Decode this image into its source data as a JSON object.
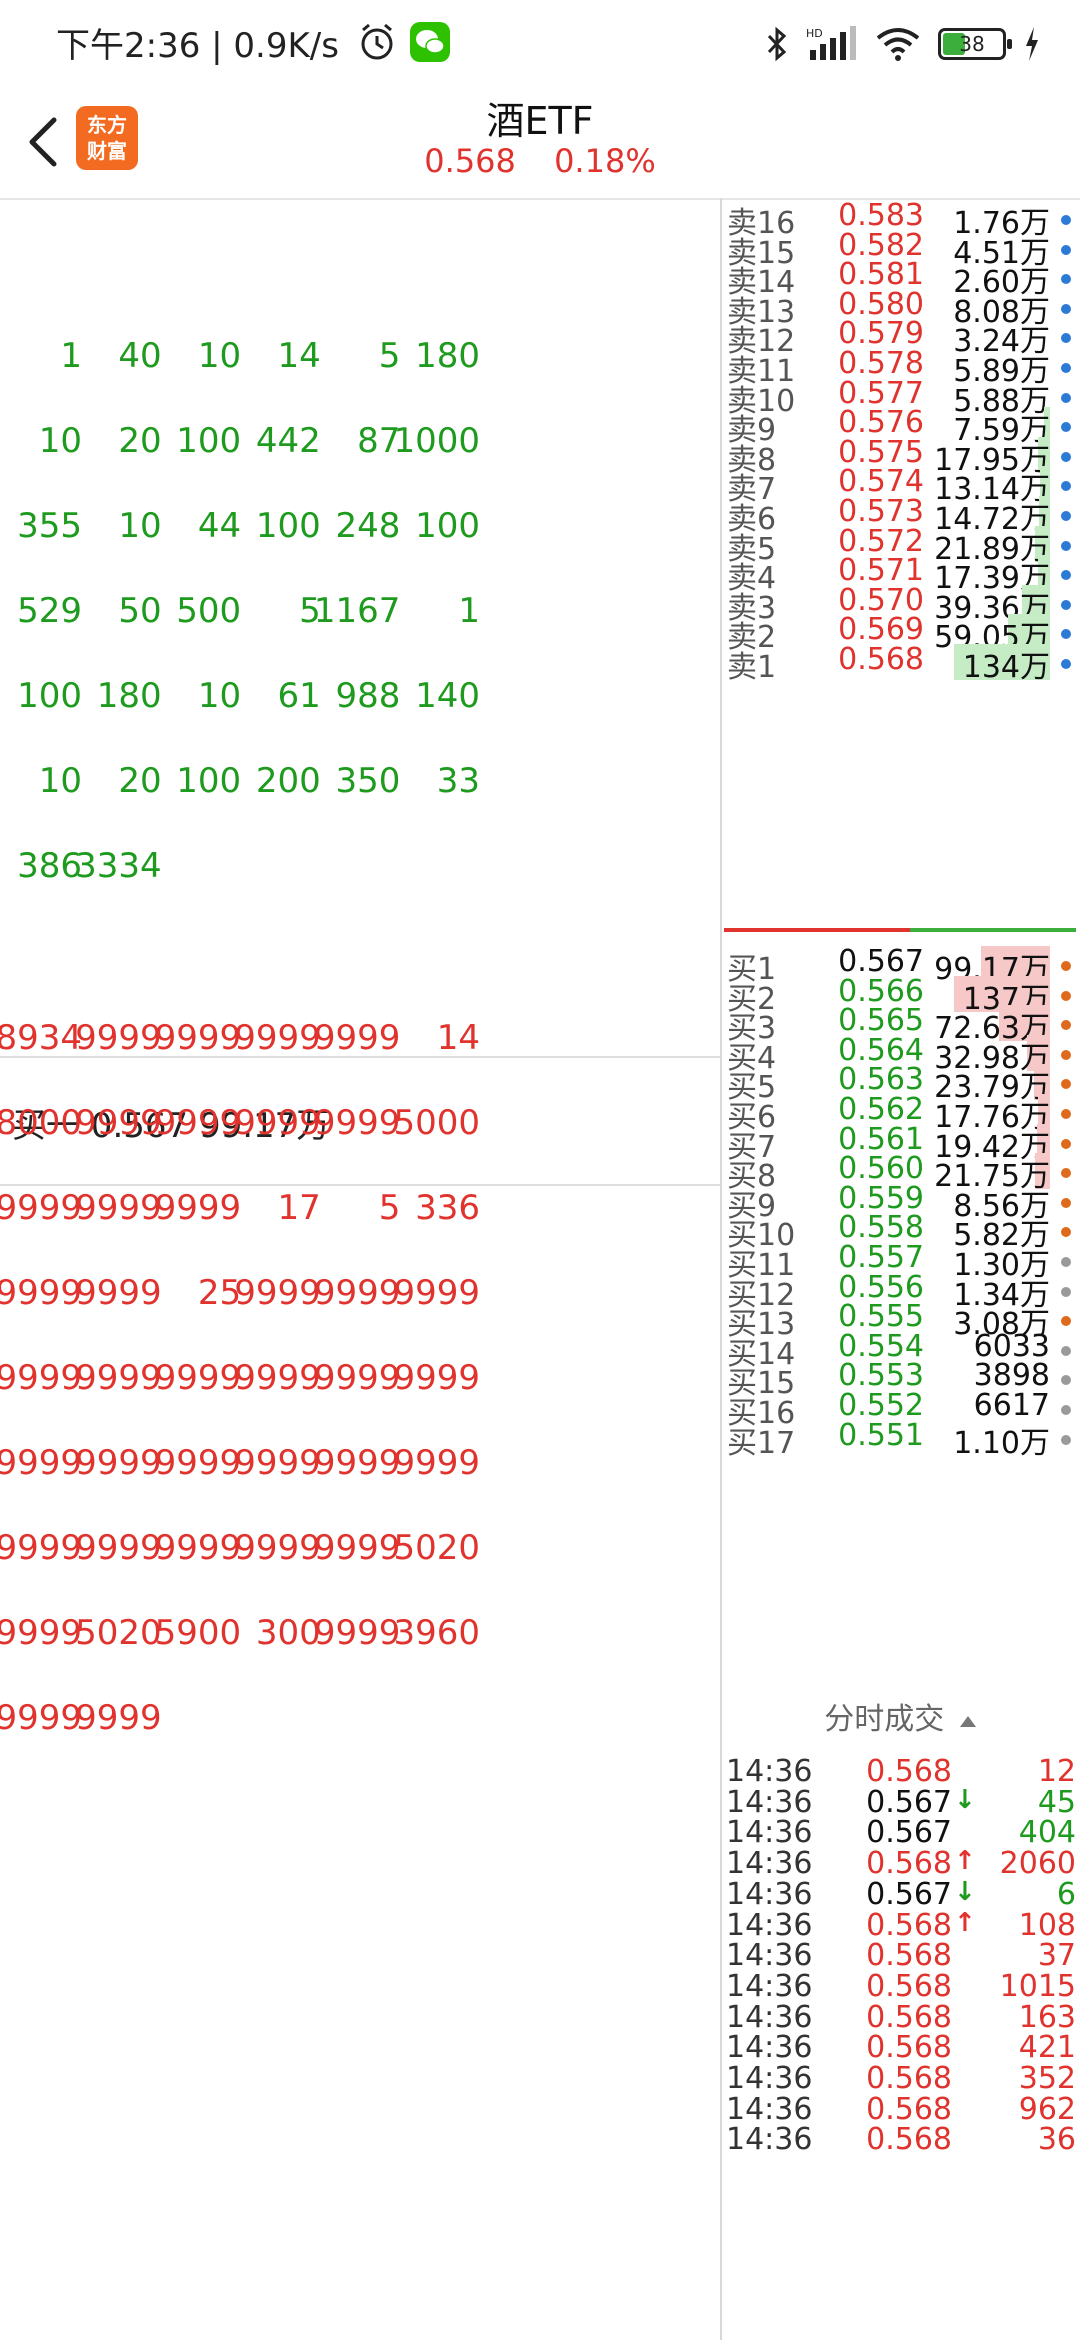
{
  "status": {
    "time_speed": "下午2:36 | 0.9K/s",
    "battery": "38",
    "icons": [
      "alarm-icon",
      "wechat-icon",
      "bluetooth-icon",
      "signal-icon",
      "wifi-icon",
      "battery-icon",
      "charging-icon"
    ]
  },
  "header": {
    "title": "酒ETF",
    "price": "0.568",
    "change": "0.18%",
    "logo_line1": "东方",
    "logo_line2": "财富"
  },
  "sell_grid": [
    [
      "1",
      "40",
      "10",
      "14",
      "5",
      "180"
    ],
    [
      "10",
      "20",
      "100",
      "442",
      "87",
      "1000"
    ],
    [
      "355",
      "10",
      "44",
      "100",
      "248",
      "100"
    ],
    [
      "529",
      "50",
      "500",
      "5",
      "1167",
      "1"
    ],
    [
      "100",
      "180",
      "10",
      "61",
      "988",
      "140"
    ],
    [
      "10",
      "20",
      "100",
      "200",
      "350",
      "33"
    ],
    [
      "386",
      "3334",
      "",
      "",
      "",
      ""
    ]
  ],
  "buy1_summary": "买一  0.567  99.17万",
  "buy_grid": [
    [
      "8934",
      "9999",
      "9999",
      "9999",
      "9999",
      "14"
    ],
    [
      "8000",
      "9999",
      "9999",
      "9999",
      "9999",
      "5000"
    ],
    [
      "9999",
      "9999",
      "9999",
      "17",
      "5",
      "336"
    ],
    [
      "9999",
      "9999",
      "25",
      "9999",
      "9999",
      "9999"
    ],
    [
      "9999",
      "9999",
      "9999",
      "9999",
      "9999",
      "9999"
    ],
    [
      "9999",
      "9999",
      "9999",
      "9999",
      "9999",
      "9999"
    ],
    [
      "9999",
      "9999",
      "9999",
      "9999",
      "9999",
      "5020"
    ],
    [
      "9999",
      "5020",
      "5900",
      "300",
      "9999",
      "3960"
    ],
    [
      "9999",
      "9999",
      "",
      "",
      "",
      ""
    ]
  ],
  "sell_levels": [
    {
      "label": "卖16",
      "price": "0.583",
      "vol": "1.76万",
      "bar": 0.0
    },
    {
      "label": "卖15",
      "price": "0.582",
      "vol": "4.51万",
      "bar": 0.0
    },
    {
      "label": "卖14",
      "price": "0.581",
      "vol": "2.60万",
      "bar": 0.0
    },
    {
      "label": "卖13",
      "price": "0.580",
      "vol": "8.08万",
      "bar": 0.0
    },
    {
      "label": "卖12",
      "price": "0.579",
      "vol": "3.24万",
      "bar": 0.0
    },
    {
      "label": "卖11",
      "price": "0.578",
      "vol": "5.89万",
      "bar": 0.0
    },
    {
      "label": "卖10",
      "price": "0.577",
      "vol": "5.88万",
      "bar": 0.0
    },
    {
      "label": "卖9",
      "price": "0.576",
      "vol": "7.59万",
      "bar": 0.06
    },
    {
      "label": "卖8",
      "price": "0.575",
      "vol": "17.95万",
      "bar": 0.13
    },
    {
      "label": "卖7",
      "price": "0.574",
      "vol": "13.14万",
      "bar": 0.1
    },
    {
      "label": "卖6",
      "price": "0.573",
      "vol": "14.72万",
      "bar": 0.11
    },
    {
      "label": "卖5",
      "price": "0.572",
      "vol": "21.89万",
      "bar": 0.16
    },
    {
      "label": "卖4",
      "price": "0.571",
      "vol": "17.39万",
      "bar": 0.13
    },
    {
      "label": "卖3",
      "price": "0.570",
      "vol": "39.36万",
      "bar": 0.29
    },
    {
      "label": "卖2",
      "price": "0.569",
      "vol": "59.05万",
      "bar": 0.44
    },
    {
      "label": "卖1",
      "price": "0.568",
      "vol": "134万",
      "bar": 1.0
    }
  ],
  "buy_levels": [
    {
      "label": "买1",
      "price": "0.567",
      "vol": "99.17万",
      "bar": 0.72,
      "dot": "#e06a1c"
    },
    {
      "label": "买2",
      "price": "0.566",
      "vol": "137万",
      "bar": 1.0,
      "dot": "#e06a1c"
    },
    {
      "label": "买3",
      "price": "0.565",
      "vol": "72.63万",
      "bar": 0.53,
      "dot": "#e06a1c"
    },
    {
      "label": "买4",
      "price": "0.564",
      "vol": "32.98万",
      "bar": 0.24,
      "dot": "#e06a1c"
    },
    {
      "label": "买5",
      "price": "0.563",
      "vol": "23.79万",
      "bar": 0.17,
      "dot": "#e06a1c"
    },
    {
      "label": "买6",
      "price": "0.562",
      "vol": "17.76万",
      "bar": 0.13,
      "dot": "#e06a1c"
    },
    {
      "label": "买7",
      "price": "0.561",
      "vol": "19.42万",
      "bar": 0.14,
      "dot": "#e06a1c"
    },
    {
      "label": "买8",
      "price": "0.560",
      "vol": "21.75万",
      "bar": 0.16,
      "dot": "#e06a1c"
    },
    {
      "label": "买9",
      "price": "0.559",
      "vol": "8.56万",
      "bar": 0.0,
      "dot": "#e06a1c"
    },
    {
      "label": "买10",
      "price": "0.558",
      "vol": "5.82万",
      "bar": 0.0,
      "dot": "#e06a1c"
    },
    {
      "label": "买11",
      "price": "0.557",
      "vol": "1.30万",
      "bar": 0.0,
      "dot": "#9a9a9a"
    },
    {
      "label": "买12",
      "price": "0.556",
      "vol": "1.34万",
      "bar": 0.0,
      "dot": "#9a9a9a"
    },
    {
      "label": "买13",
      "price": "0.555",
      "vol": "3.08万",
      "bar": 0.0,
      "dot": "#e06a1c"
    },
    {
      "label": "买14",
      "price": "0.554",
      "vol": "6033",
      "bar": 0.0,
      "dot": "#9a9a9a"
    },
    {
      "label": "买15",
      "price": "0.553",
      "vol": "3898",
      "bar": 0.0,
      "dot": "#9a9a9a"
    },
    {
      "label": "买16",
      "price": "0.552",
      "vol": "6617",
      "bar": 0.0,
      "dot": "#9a9a9a"
    },
    {
      "label": "买17",
      "price": "0.551",
      "vol": "1.10万",
      "bar": 0.0,
      "dot": "#9a9a9a"
    }
  ],
  "ticks_title": "分时成交",
  "ticks": [
    {
      "time": "14:36",
      "price": "0.568",
      "dir": "",
      "vol": "12",
      "color": "red"
    },
    {
      "time": "14:36",
      "price": "0.567",
      "dir": "↓",
      "vol": "45",
      "color": "black"
    },
    {
      "time": "14:36",
      "price": "0.567",
      "dir": "",
      "vol": "404",
      "color": "black"
    },
    {
      "time": "14:36",
      "price": "0.568",
      "dir": "↑",
      "vol": "2060",
      "color": "red"
    },
    {
      "time": "14:36",
      "price": "0.567",
      "dir": "↓",
      "vol": "6",
      "color": "black"
    },
    {
      "time": "14:36",
      "price": "0.568",
      "dir": "↑",
      "vol": "108",
      "color": "red"
    },
    {
      "time": "14:36",
      "price": "0.568",
      "dir": "",
      "vol": "37",
      "color": "red"
    },
    {
      "time": "14:36",
      "price": "0.568",
      "dir": "",
      "vol": "1015",
      "color": "red"
    },
    {
      "time": "14:36",
      "price": "0.568",
      "dir": "",
      "vol": "163",
      "color": "red"
    },
    {
      "time": "14:36",
      "price": "0.568",
      "dir": "",
      "vol": "421",
      "color": "red"
    },
    {
      "time": "14:36",
      "price": "0.568",
      "dir": "",
      "vol": "352",
      "color": "red"
    },
    {
      "time": "14:36",
      "price": "0.568",
      "dir": "",
      "vol": "962",
      "color": "red"
    },
    {
      "time": "14:36",
      "price": "0.568",
      "dir": "",
      "vol": "36",
      "color": "red"
    }
  ],
  "colors": {
    "red": "#e0332e",
    "green": "#1e9b1e",
    "sell_bar": "#c5ecc5",
    "buy_bar": "#f7c8c8",
    "sell_dot": "#2b7bd6"
  }
}
